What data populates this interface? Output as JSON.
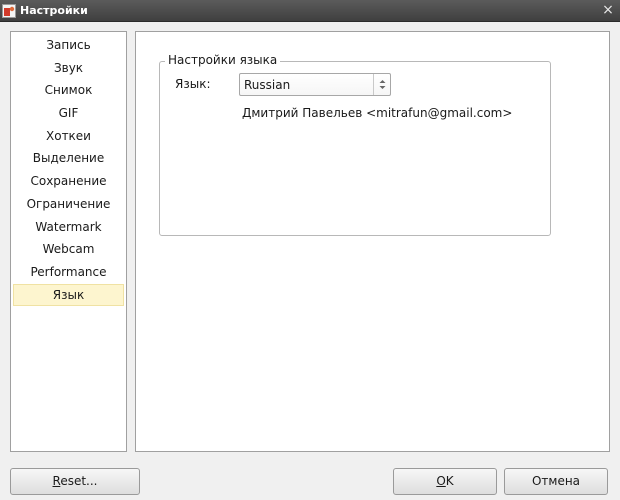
{
  "window": {
    "title": "Настройки",
    "close_glyph": "×"
  },
  "sidebar": {
    "items": [
      {
        "label": "Запись"
      },
      {
        "label": "Звук"
      },
      {
        "label": "Снимок"
      },
      {
        "label": "GIF"
      },
      {
        "label": "Хоткеи"
      },
      {
        "label": "Выделение"
      },
      {
        "label": "Сохранение"
      },
      {
        "label": "Ограничение"
      },
      {
        "label": "Watermark"
      },
      {
        "label": "Webcam"
      },
      {
        "label": "Performance"
      },
      {
        "label": "Язык",
        "selected": true
      }
    ]
  },
  "language_settings": {
    "group_title": "Настройки языка",
    "language_label": "Язык:",
    "language_value": "Russian",
    "author": "Дмитрий Павельев <mitrafun@gmail.com>"
  },
  "buttons": {
    "reset_first": "R",
    "reset_rest": "eset...",
    "ok_first": "O",
    "ok_rest": "K",
    "cancel": "Отмена"
  },
  "colors": {
    "selected_item_bg": "#fdf5cf",
    "titlebar": "#4a4a4a",
    "app_icon_red": "#d23a2a"
  },
  "icons": {
    "app": "app-icon",
    "close": "close-icon",
    "select": "select-arrows-icon"
  }
}
